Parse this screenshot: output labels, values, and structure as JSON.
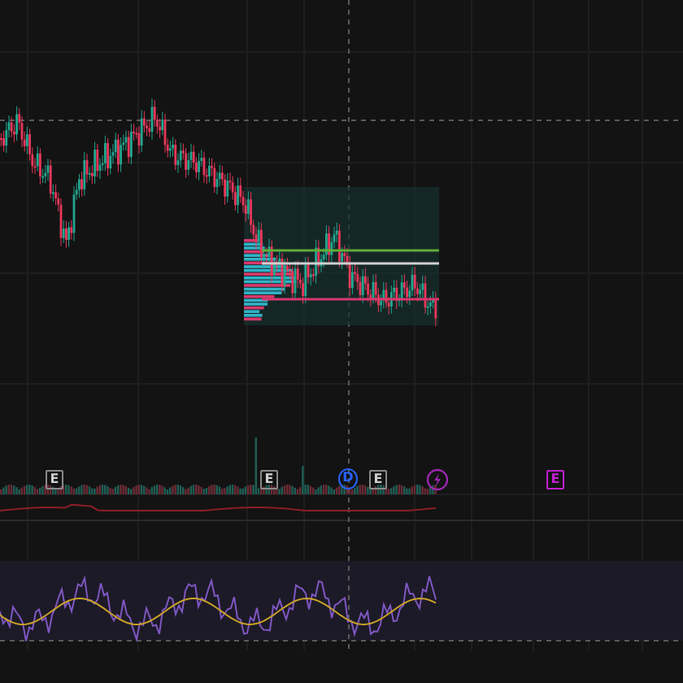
{
  "event_markers": [
    {
      "kind": "earnings",
      "label": "E",
      "color": "#8a8a8a"
    },
    {
      "kind": "earnings",
      "label": "E",
      "color": "#8a8a8a"
    },
    {
      "kind": "dividend",
      "label": "D",
      "color": "#2962ff"
    },
    {
      "kind": "earnings",
      "label": "E",
      "color": "#8a8a8a"
    },
    {
      "kind": "split",
      "color": "#9c27b0"
    },
    {
      "kind": "earnings",
      "label": "E",
      "color": "#c21fd1"
    }
  ]
}
